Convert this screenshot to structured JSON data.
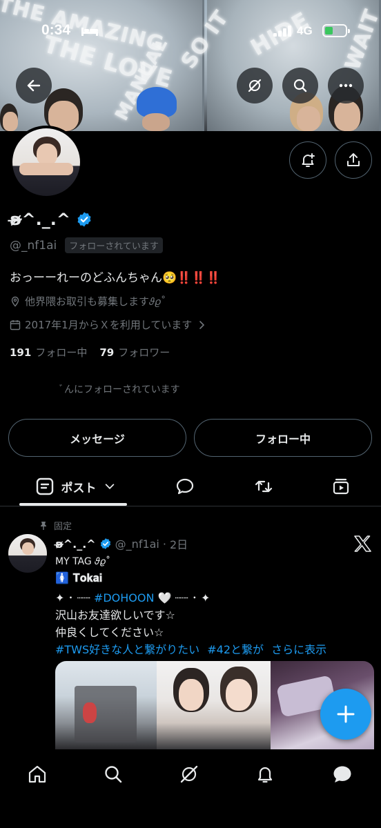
{
  "status_bar": {
    "time": "0:34",
    "network": "4G"
  },
  "banner": {
    "words": [
      "THE AMAZING",
      "THE LOVE",
      "MANUAL",
      "SO IT",
      "HIDE",
      "WAIT"
    ]
  },
  "profile": {
    "display_name": "ʚ̴̶̷̷^._.^",
    "handle": "@_nf1ai",
    "follows_you": "フォローされています",
    "bio": "おっーーれーのどふんちゃん🥺‼️‼️‼️",
    "location": "他界隈お取引も募集します𝜗𝜚˚",
    "joined": "2017年1月からＸを利用しています",
    "following_count": "191",
    "following_label": "フォロー中",
    "followers_count": "79",
    "followers_label": "フォロワー",
    "followed_by": "ﾞんにフォローされています",
    "message_button": "メッセージ",
    "following_button": "フォロー中"
  },
  "tabs": {
    "posts_label": "ポスト"
  },
  "pinned_tweet": {
    "pinned_label": "固定",
    "name": "ʚ̴̶̷^._.^",
    "handle": "@_nf1ai",
    "time": "2日",
    "line1": "MY TAG 𝜗𝜚˚",
    "line2": "🚺 𝐓𝐨𝐤𝐚𝐢",
    "line3_prefix": "✦ ･ ┈┈  ",
    "line3_tag": "#DOHOON",
    "line3_suffix": " 🤍  ┈┈ ･ ✦",
    "line4": "沢山お友達欲しいです☆",
    "line5": "仲良くしてください☆",
    "tag1": "#TWS好きな人と繋がりたい",
    "tag2": "#42と繋が",
    "show_more": "さらに表示"
  },
  "colors": {
    "accent": "#1d9bf0",
    "background": "#000000",
    "text": "#e7e9ea",
    "muted": "#71767b",
    "border": "#536471"
  },
  "icons": {
    "back": "arrow-left-icon",
    "grok": "grok-icon",
    "search": "search-icon",
    "more": "more-icon",
    "notify": "bell-plus-icon",
    "share": "share-icon"
  }
}
